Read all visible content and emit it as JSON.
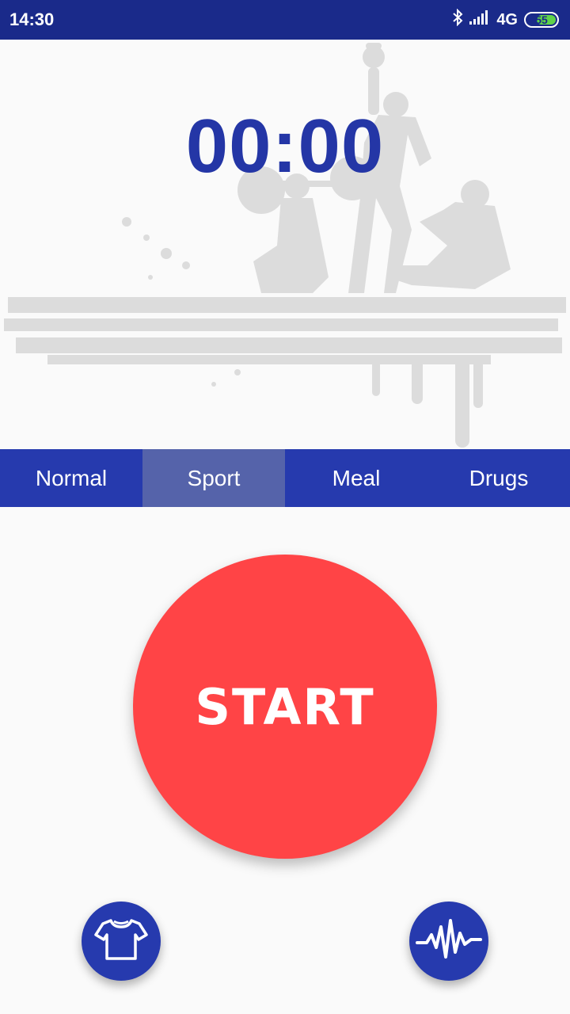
{
  "status_bar": {
    "time": "14:30",
    "network": "4G",
    "battery": "55",
    "icons": [
      "bluetooth-icon",
      "signal-icon",
      "battery-icon"
    ]
  },
  "timer": {
    "value": "00:00",
    "color": "#2436a6"
  },
  "tabs": [
    {
      "label": "Normal",
      "active": false
    },
    {
      "label": "Sport",
      "active": true
    },
    {
      "label": "Meal",
      "active": false
    },
    {
      "label": "Drugs",
      "active": false
    }
  ],
  "start_button": {
    "label": "START",
    "color": "#ff4446"
  },
  "bottom_actions": [
    {
      "icon": "tshirt-icon"
    },
    {
      "icon": "pulse-icon"
    }
  ],
  "colors": {
    "primary": "#263aae",
    "status_bar": "#1a2a8a",
    "accent": "#ff4446"
  }
}
